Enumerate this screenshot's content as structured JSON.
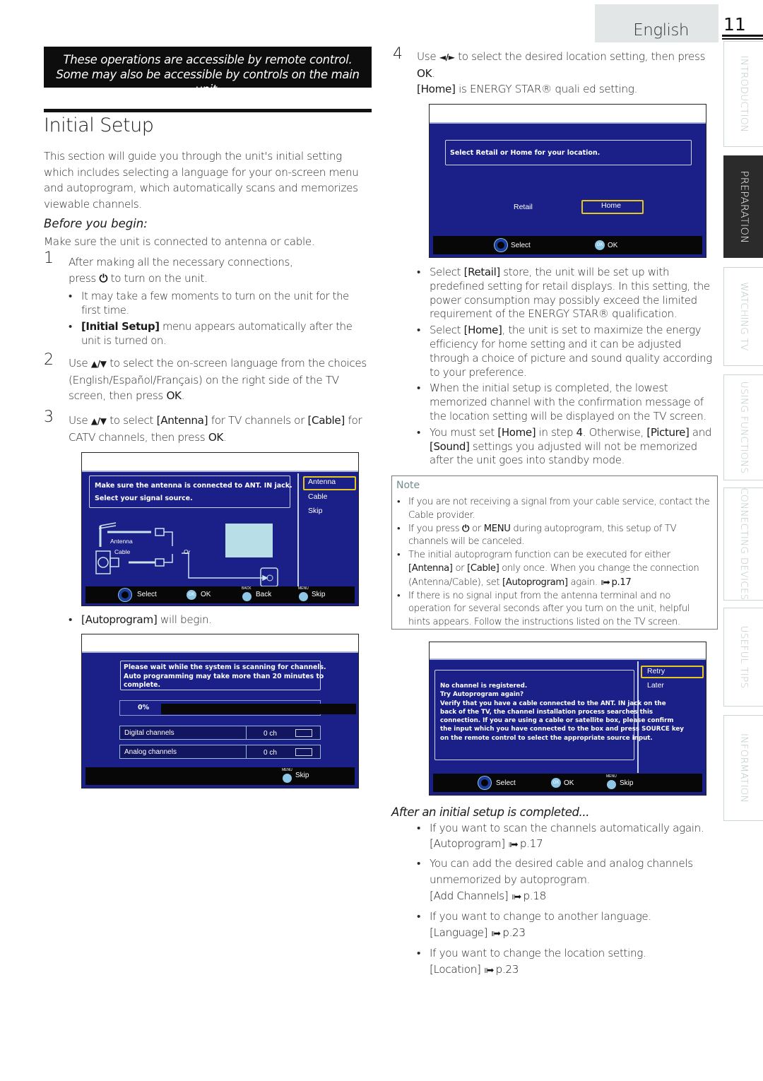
{
  "header": {
    "language_tab": "English",
    "page_number": "11"
  },
  "side_tabs": [
    {
      "label": "INTRODUCTION",
      "active": false
    },
    {
      "label": "PREPARATION",
      "active": true
    },
    {
      "label": "WATCHING TV",
      "active": false
    },
    {
      "label": "USING FUNCTIONS",
      "active": false
    },
    {
      "label": "CONNECTING DEVICES",
      "active": false
    },
    {
      "label": "USEFUL TIPS",
      "active": false
    },
    {
      "label": "INFORMATION",
      "active": false
    }
  ],
  "banner": {
    "line1": "These operations are accessible by remote control.",
    "line2": "Some may also be accessible by controls on the main unit."
  },
  "section": {
    "title": "Initial Setup",
    "intro": "This section will guide you through the unit's initial setting which includes selecting a language for your on-screen menu and autoprogram, which automatically scans and memorizes viewable channels.",
    "before_heading": "Before you begin:",
    "before_text": "Make sure the unit is connected to antenna or cable."
  },
  "steps": {
    "s1": {
      "num": "1",
      "text_a": "After making all the necessary connections,",
      "text_b1": "press",
      "power_icon": "power-icon",
      "text_b2": "to turn on the unit.",
      "bullets": [
        {
          "text": "It may take a few moments to turn on the unit for the first time."
        },
        {
          "bold": "[Initial Setup]",
          "text": " menu appears automatically after the unit is turned on."
        }
      ]
    },
    "s2": {
      "num": "2",
      "use": "Use",
      "keys": "▲/▼",
      "text": "to select the on-screen language from the choices (English/Español/Français) on the right side of the TV screen, then press",
      "ok": "OK",
      "end": "."
    },
    "s3": {
      "num": "3",
      "use": "Use",
      "keys": "▲/▼",
      "t1": "to select",
      "b1": "[Antenna]",
      "t2": "for TV channels or",
      "b2": "[Cable]",
      "t3": "for CATV channels, then press",
      "ok": "OK",
      "end": "."
    },
    "s4": {
      "num": "4",
      "use": "Use",
      "keys": "◄/►",
      "text": "to select the desired location setting, then press",
      "ok": "OK",
      "end": ".",
      "home_bold": "[Home]",
      "home_text": " is ENERGY STAR® quali  ed setting.",
      "bullets": [
        {
          "pre": "Select ",
          "bold": "[Retail]",
          "text": " store, the unit will be set up with predefined setting for retail displays. In this setting, the power consumption may possibly exceed the limited requirement of the ENERGY STAR® qualification."
        },
        {
          "pre": "Select ",
          "bold": "[Home]",
          "text": ", the unit is set to maximize the energy efficiency for home setting and it can be adjusted through a choice of picture and sound quality according to your preference."
        },
        {
          "pre": "",
          "bold": "",
          "text": "When the initial setup is completed, the lowest memorized channel with the confirmation message of the location setting will be displayed on the TV screen."
        },
        {
          "pre": "You must set ",
          "bold": "[Home]",
          "mid": " in step ",
          "bold2": "4",
          "mid2": ". Otherwise, ",
          "bold3": "[Picture]",
          "mid3": " and ",
          "bold4": "[Sound]",
          "text": " settings you adjusted will not be memorized after the unit goes into standby mode."
        }
      ]
    }
  },
  "screen_signal": {
    "message_line1": "Make sure the antenna is connected to ANT. IN jack.",
    "message_line2": "Select your signal source.",
    "options": [
      "Antenna",
      "Cable",
      "Skip"
    ],
    "selected": "Antenna",
    "diagram": {
      "antenna": "Antenna",
      "cable": "Cable",
      "or": "Or"
    },
    "footer": [
      {
        "icon": "dpad-icon",
        "label": "Select"
      },
      {
        "icon": "ok-button-icon",
        "key": "OK",
        "label": "OK"
      },
      {
        "icon": "back-button-icon",
        "key": "BACK",
        "label": "Back"
      },
      {
        "icon": "menu-button-icon",
        "key": "MENU",
        "label": "Skip"
      }
    ]
  },
  "autoprogram_note": {
    "bold": "[Autoprogram]",
    "text": " will begin."
  },
  "screen_scan": {
    "message": "Please wait while the system is scanning for channels. Auto programming may take more than 20 minutes to complete.",
    "progress_label": "0%",
    "progress_value": 0,
    "rows": [
      {
        "label": "Digital channels",
        "value": "0 ch"
      },
      {
        "label": "Analog channels",
        "value": "0 ch"
      }
    ],
    "footer": [
      {
        "icon": "menu-button-icon",
        "key": "MENU",
        "label": "Skip"
      }
    ]
  },
  "screen_location": {
    "message": "Select Retail or Home for your location.",
    "options": [
      "Retail",
      "Home"
    ],
    "selected": "Home",
    "footer": [
      {
        "icon": "dpad-lr-icon",
        "label": "Select"
      },
      {
        "icon": "ok-button-icon",
        "key": "OK",
        "label": "OK"
      }
    ]
  },
  "note": {
    "label": "Note",
    "items": [
      {
        "text": "If you are not receiving a signal from your cable service, contact the Cable provider."
      },
      {
        "pre": "If you press",
        "bold": "MENU",
        "text": "during autoprogram, this setup of TV channels will be canceled."
      },
      {
        "pre": "The initial autoprogram function can be executed for either",
        "b1": "[Antenna]",
        "m1": "or",
        "b2": "[Cable]",
        "m2": "only once. When you change the connection (Antenna/Cable), set",
        "b3": "[Autoprogram]",
        "m3": "again.",
        "ref": "p.17"
      },
      {
        "text": "If there is no signal input from the antenna terminal and no operation for several seconds after you turn on the unit, helpful hints appears. Follow the instructions listed on the TV screen."
      }
    ]
  },
  "screen_nochannel": {
    "message": "No channel is registered.\nTry Autoprogram again?\nVerify that you have a cable connected to the ANT. IN jack on the back of the TV, the channel installation process searches this connection. If you are using a cable or satellite box, please confirm the input which you have connected to the box and press SOURCE key on the remote control to select the appropriate source input.",
    "options": [
      "Retry",
      "Later"
    ],
    "selected": "Retry",
    "footer": [
      {
        "icon": "dpad-icon",
        "label": "Select"
      },
      {
        "icon": "ok-button-icon",
        "key": "OK",
        "label": "OK"
      },
      {
        "icon": "menu-button-icon",
        "key": "MENU",
        "label": "Skip"
      }
    ]
  },
  "after_setup": {
    "heading": "After an initial setup is completed...",
    "items": [
      {
        "text": "If you want to scan the channels automatically again.",
        "ref_label": "[Autoprogram]",
        "ref_page": "p.17"
      },
      {
        "text": "You can add the desired cable and analog channels unmemorized by autoprogram.",
        "ref_label": "[Add Channels]",
        "ref_page": "p.18"
      },
      {
        "text": "If you want to change to another language.",
        "ref_label": "[Language]",
        "ref_page": "p.23"
      },
      {
        "text": "If you want to change the location setting.",
        "ref_label": "[Location]",
        "ref_page": "p.23"
      }
    ],
    "arrow_glyph": "ııı➡"
  }
}
